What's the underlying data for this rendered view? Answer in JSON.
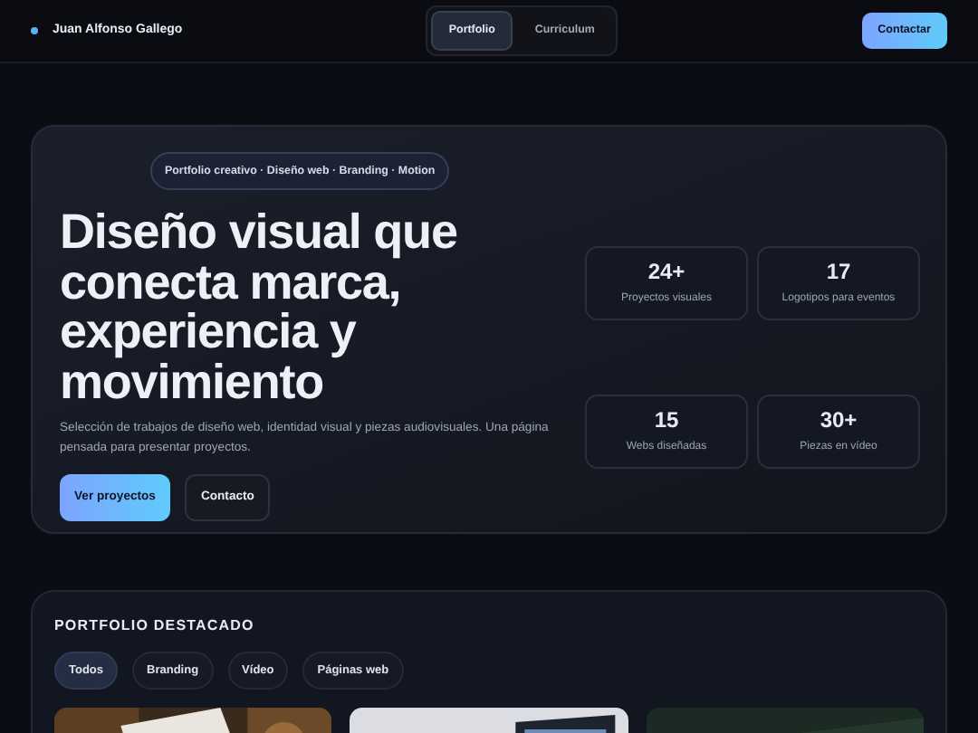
{
  "brand": {
    "name": "Juan Alfonso Gallego"
  },
  "nav_tabs": [
    {
      "label": "Portfolio",
      "selected": true
    },
    {
      "label": "Curriculum",
      "selected": false
    }
  ],
  "nav_button": "Contactar",
  "hero": {
    "tagline": "Portfolio creativo · Diseño web · Branding · Motion",
    "title": "Diseño visual que conecta marca, experiencia y movimiento",
    "description": "Selección de trabajos de diseño web, identidad visual y piezas audiovisuales. Una página pensada para presentar proyectos.",
    "buttons": [
      {
        "label": "Ver proyectos",
        "kind": "primary"
      },
      {
        "label": "Contacto",
        "kind": "secondary"
      }
    ],
    "stats": [
      {
        "value": "24+",
        "label": "Proyectos visuales"
      },
      {
        "value": "17",
        "label": "Logotipos para eventos"
      },
      {
        "value": "15",
        "label": "Webs diseñadas"
      },
      {
        "value": "30+",
        "label": "Piezas en vídeo"
      }
    ]
  },
  "portfolio": {
    "title": "PORTFOLIO DESTACADO",
    "filters": [
      {
        "label": "Todos",
        "selected": true
      },
      {
        "label": "Branding",
        "selected": false
      },
      {
        "label": "Vídeo",
        "selected": false
      },
      {
        "label": "Páginas web",
        "selected": false
      }
    ]
  }
}
